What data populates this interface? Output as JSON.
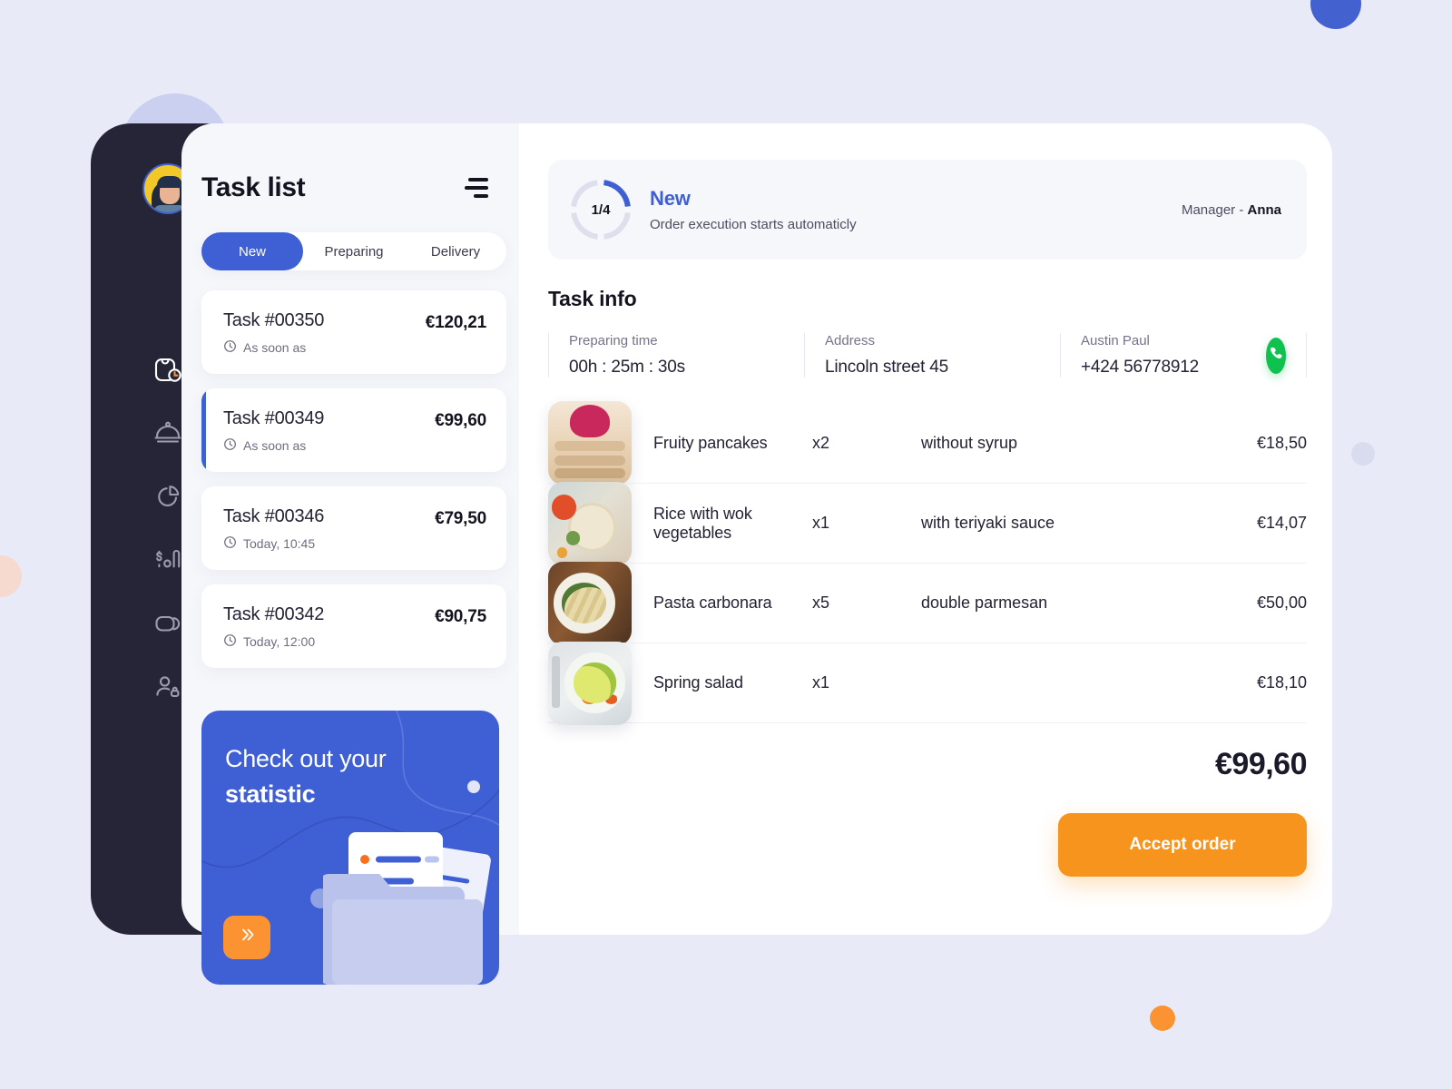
{
  "sidebar": {
    "avatar_name": "user-avatar",
    "items": [
      {
        "icon": "orders-bag-clock-icon",
        "label": "Orders",
        "active": true
      },
      {
        "icon": "food-dome-icon",
        "label": "Menu",
        "active": false
      },
      {
        "icon": "pie-chart-icon",
        "label": "Analytics",
        "active": false
      },
      {
        "icon": "finance-bars-icon",
        "label": "Finance",
        "active": false
      },
      {
        "icon": "cards-stack-icon",
        "label": "Cards",
        "active": false
      },
      {
        "icon": "user-lock-icon",
        "label": "Staff",
        "active": false
      }
    ]
  },
  "task_panel": {
    "title": "Task list",
    "filter_icon": "filter-lines-icon",
    "tabs": [
      {
        "label": "New",
        "active": true
      },
      {
        "label": "Preparing",
        "active": false
      },
      {
        "label": "Delivery",
        "active": false
      }
    ],
    "tasks": [
      {
        "name": "Task #00350",
        "time": "As soon as",
        "price": "€120,21",
        "selected": false
      },
      {
        "name": "Task #00349",
        "time": "As soon as",
        "price": "€99,60",
        "selected": true
      },
      {
        "name": "Task #00346",
        "time": "Today, 10:45",
        "price": "€79,50",
        "selected": false
      },
      {
        "name": "Task #00342",
        "time": "Today, 12:00",
        "price": "€90,75",
        "selected": false
      }
    ],
    "promo": {
      "line1": "Check out your",
      "line2": "statistic",
      "button_icon": "chevron-right-icon"
    }
  },
  "main": {
    "status": {
      "progress_label": "1/4",
      "progress_current": 1,
      "progress_total": 4,
      "title": "New",
      "subtitle": "Order execution starts automaticly",
      "manager_label": "Manager - ",
      "manager_name": "Anna"
    },
    "section_title": "Task info",
    "info": [
      {
        "label": "Preparing time",
        "value": "00h : 25m : 30s"
      },
      {
        "label": "Address",
        "value": "Lincoln street 45"
      },
      {
        "label": "Austin Paul",
        "value": "+424 56778912"
      }
    ],
    "call_icon": "phone-icon",
    "items": [
      {
        "image": "f-pancake",
        "name": "Fruity pancakes",
        "qty": "x2",
        "note": "without syrup",
        "price": "€18,50"
      },
      {
        "image": "f-rice",
        "name": "Rice with wok vegetables",
        "qty": "x1",
        "note": "with teriyaki sauce",
        "price": "€14,07"
      },
      {
        "image": "f-pasta",
        "name": "Pasta carbonara",
        "qty": "x5",
        "note": "double parmesan",
        "price": "€50,00"
      },
      {
        "image": "f-salad",
        "name": "Spring salad",
        "qty": "x1",
        "note": "",
        "price": "€18,10"
      }
    ],
    "total": "€99,60",
    "accept_label": "Accept order"
  },
  "colors": {
    "accent_blue": "#3f5fd4",
    "accent_orange": "#f7941e",
    "call_green": "#0fc14e",
    "sidebar_dark": "#262538",
    "page_bg": "#e8eaf8"
  }
}
